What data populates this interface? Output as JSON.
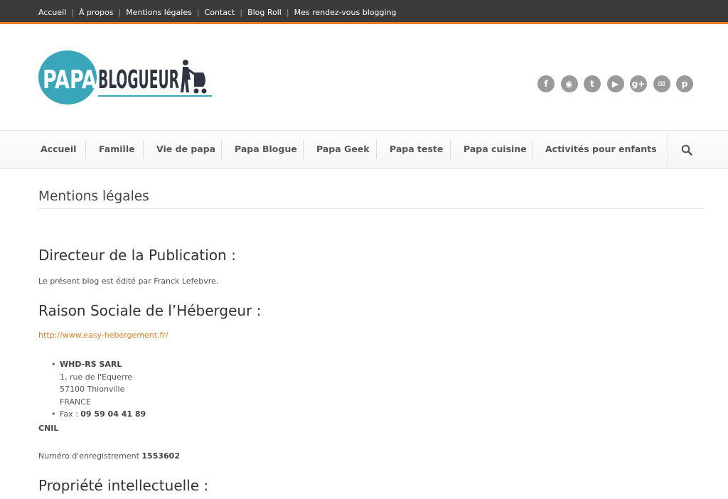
{
  "topnav": {
    "items": [
      "Accueil",
      "À propos",
      "Mentions légales",
      "Contact",
      "Blog Roll",
      "Mes rendez-vous blogging"
    ],
    "separator": "|"
  },
  "logo": {
    "part1": "PAPA",
    "part2": "BLOGUEUR"
  },
  "social": [
    {
      "icon": "facebook-icon",
      "glyph": "f"
    },
    {
      "icon": "rss-icon",
      "glyph": "◉"
    },
    {
      "icon": "twitter-icon",
      "glyph": "t"
    },
    {
      "icon": "youtube-icon",
      "glyph": "▶"
    },
    {
      "icon": "google-plus-icon",
      "glyph": "g+"
    },
    {
      "icon": "email-icon",
      "glyph": "✉"
    },
    {
      "icon": "pinterest-icon",
      "glyph": "p"
    }
  ],
  "mainnav": {
    "items": [
      "Accueil",
      "Famille",
      "Vie de papa",
      "Papa Blogue",
      "Papa Geek",
      "Papa teste",
      "Papa cuisine",
      "Activités pour enfants"
    ]
  },
  "content": {
    "page_title": "Mentions légales",
    "h_director": "Directeur de la Publication :",
    "director_text": "Le présent blog est édité par Franck Lefebvre.",
    "h_host": "Raison Sociale de l’Hébergeur :",
    "host_link": "http://www.easy-hebergement.fr/",
    "host_name": "WHD-RS SARL",
    "host_address": [
      "1, rue de l'Equerre",
      "57100 Thionville",
      "FRANCE"
    ],
    "fax_label": "Fax : ",
    "fax_value": "09 59 04 41 89",
    "cnil_label": "CNIL",
    "reg_label": "Numéro d'enregistrement ",
    "reg_value": "1553602",
    "h_ip": "Propriété intellectuelle :"
  },
  "colors": {
    "accent": "#e67e22",
    "logo_teal": "#3aa6b9",
    "logo_dark": "#2f3542",
    "topbar": "#3a3a3a"
  }
}
